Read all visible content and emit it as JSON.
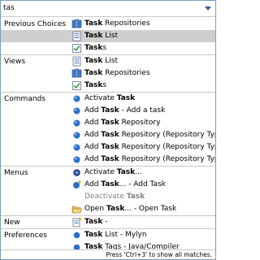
{
  "search": {
    "value": "tas"
  },
  "match_term": "Task",
  "sections": [
    {
      "category": "Previous Choices",
      "items": [
        {
          "pre": "",
          "bold": "Task",
          "post": " Repositories",
          "icon": "task-repositories-icon",
          "selected": false,
          "disabled": false
        },
        {
          "pre": "",
          "bold": "Task",
          "post": " List",
          "icon": "task-list-icon",
          "selected": true,
          "disabled": false
        },
        {
          "pre": "",
          "bold": "Task",
          "post": "s",
          "icon": "tasks-view-icon",
          "selected": false,
          "disabled": false
        }
      ]
    },
    {
      "category": "Views",
      "items": [
        {
          "pre": "",
          "bold": "Task",
          "post": " List",
          "icon": "task-list-icon",
          "selected": false,
          "disabled": false
        },
        {
          "pre": "",
          "bold": "Task",
          "post": " Repositories",
          "icon": "task-repositories-icon",
          "selected": false,
          "disabled": false
        },
        {
          "pre": "",
          "bold": "Task",
          "post": "s",
          "icon": "tasks-view-icon",
          "selected": false,
          "disabled": false
        }
      ]
    },
    {
      "category": "Commands",
      "items": [
        {
          "pre": "Activate ",
          "bold": "Task",
          "post": "",
          "icon": "command-icon",
          "selected": false,
          "disabled": false
        },
        {
          "pre": "Add ",
          "bold": "Task",
          "post": " - Add a task",
          "icon": "command-icon",
          "selected": false,
          "disabled": false
        },
        {
          "pre": "Add ",
          "bold": "Task",
          "post": " Repository",
          "icon": "command-icon",
          "selected": false,
          "disabled": false
        },
        {
          "pre": "Add ",
          "bold": "Task",
          "post": " Repository (Repository Type:",
          "icon": "command-icon",
          "selected": false,
          "disabled": false
        },
        {
          "pre": "Add ",
          "bold": "Task",
          "post": " Repository (Repository Type:",
          "icon": "command-icon",
          "selected": false,
          "disabled": false
        },
        {
          "pre": "Add ",
          "bold": "Task",
          "post": " Repository (Repository Type:",
          "icon": "command-icon",
          "selected": false,
          "disabled": false
        }
      ]
    },
    {
      "category": "Menus",
      "items": [
        {
          "pre": "Activate ",
          "bold": "Task",
          "post": "...",
          "icon": "activate-task-icon",
          "selected": false,
          "disabled": false
        },
        {
          "pre": "Add ",
          "bold": "Task",
          "post": "... - Add Task",
          "icon": "add-task-icon",
          "selected": false,
          "disabled": false
        },
        {
          "pre": "Deactivate ",
          "bold": "Task",
          "post": "",
          "icon": "none",
          "selected": false,
          "disabled": true
        },
        {
          "pre": "Open ",
          "bold": "Task",
          "post": "... - Open Task",
          "icon": "open-folder-icon",
          "selected": false,
          "disabled": false
        }
      ]
    },
    {
      "category": "New",
      "items": [
        {
          "pre": "",
          "bold": "Task",
          "post": " -",
          "icon": "new-task-icon",
          "selected": false,
          "disabled": false
        }
      ]
    },
    {
      "category": "Preferences",
      "items": [
        {
          "pre": "",
          "bold": "Task",
          "post": " List - Mylyn",
          "icon": "preferences-icon",
          "selected": false,
          "disabled": false
        },
        {
          "pre": "",
          "bold": "Task",
          "post": " Tags - Java/Compiler",
          "icon": "preferences-icon",
          "selected": false,
          "disabled": false
        }
      ]
    }
  ],
  "status": {
    "text": "Press 'Ctrl+3' to show all matches."
  },
  "colors": {
    "selection": "#cfcfcf",
    "border": "#7f9db9",
    "separator": "#c8c8c8",
    "command_blue": "#2b6fc9"
  }
}
